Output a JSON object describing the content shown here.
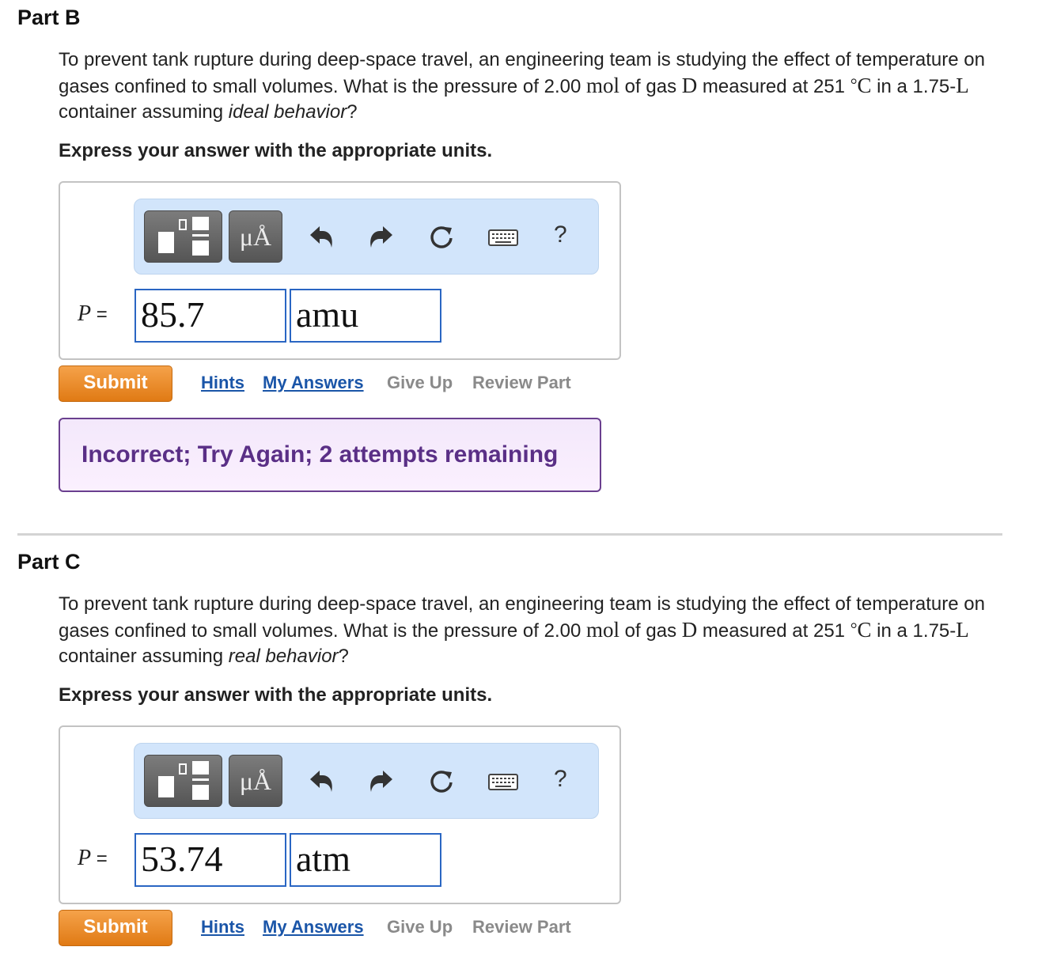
{
  "parts": [
    {
      "title": "Part B",
      "question": {
        "text1": "To prevent tank rupture during deep-space travel, an engineering team is studying the effect of temperature on gases confined to small volumes. What is the pressure of 2.00 ",
        "mol": "mol",
        "text2": " of gas ",
        "gas": "D",
        "text3": " measured at 251 ",
        "deg": "°",
        "C": "C",
        "text4": " in a 1.75-",
        "L": "L",
        "text5": " container assuming ",
        "behavior": "ideal behavior",
        "text6": "?"
      },
      "instruction": "Express your answer with the appropriate units.",
      "toolbar": {
        "units_label": "μÅ",
        "help_label": "?"
      },
      "answer": {
        "variable": "P",
        "equals": " =",
        "value": "85.7",
        "unit": "amu"
      },
      "actions": {
        "submit": "Submit",
        "hints": "Hints",
        "my_answers": "My Answers",
        "give_up": "Give Up",
        "review": "Review Part"
      },
      "feedback": "Incorrect; Try Again; 2 attempts remaining"
    },
    {
      "title": "Part C",
      "question": {
        "text1": "To prevent tank rupture during deep-space travel, an engineering team is studying the effect of temperature on gases confined to small volumes. What is the pressure of 2.00 ",
        "mol": "mol",
        "text2": " of gas ",
        "gas": "D",
        "text3": " measured at 251 ",
        "deg": "°",
        "C": "C",
        "text4": " in a 1.75-",
        "L": "L",
        "text5": " container assuming ",
        "behavior": "real behavior",
        "text6": "?"
      },
      "instruction": "Express your answer with the appropriate units.",
      "toolbar": {
        "units_label": "μÅ",
        "help_label": "?"
      },
      "answer": {
        "variable": "P",
        "equals": " =",
        "value": "53.74",
        "unit": "atm"
      },
      "actions": {
        "submit": "Submit",
        "hints": "Hints",
        "my_answers": "My Answers",
        "give_up": "Give Up",
        "review": "Review Part"
      }
    }
  ],
  "colors": {
    "submit": "#e88a2a",
    "link": "#1a55a8",
    "disabled_link": "#8a8a8a",
    "feedback_text": "#5a2f86",
    "toolbar_bg": "#d2e5fb",
    "input_border": "#2a66c3"
  }
}
